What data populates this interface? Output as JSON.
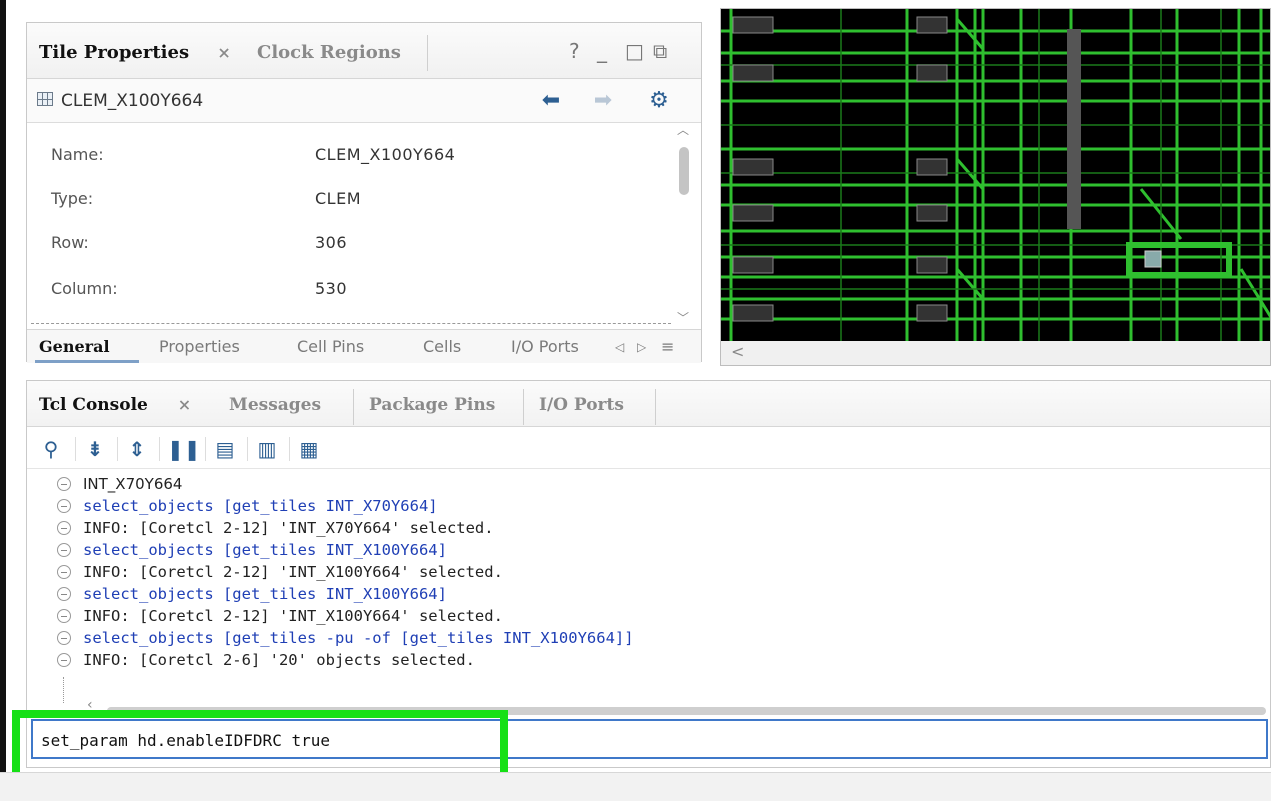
{
  "tile_panel": {
    "tabs": [
      {
        "label": "Tile Properties",
        "active": true
      },
      {
        "label": "Clock Regions",
        "active": false
      }
    ],
    "controls": {
      "help": "?",
      "minimize": "_",
      "maximize": "□",
      "float": "⧉"
    },
    "tile_name": "CLEM_X100Y664",
    "properties": [
      {
        "key": "Name:",
        "value": "CLEM_X100Y664"
      },
      {
        "key": "Type:",
        "value": "CLEM"
      },
      {
        "key": "Row:",
        "value": "306"
      },
      {
        "key": "Column:",
        "value": "530"
      }
    ],
    "bottom_tabs": [
      "General",
      "Properties",
      "Cell Pins",
      "Cells",
      "I/O Ports"
    ]
  },
  "console": {
    "tabs": [
      {
        "label": "Tcl Console",
        "active": true
      },
      {
        "label": "Messages",
        "active": false
      },
      {
        "label": "Package Pins",
        "active": false
      },
      {
        "label": "I/O Ports",
        "active": false
      }
    ],
    "toolbar": [
      "search-icon",
      "collapse-all-icon",
      "expand-all-icon",
      "pause-icon",
      "clear-icon",
      "split-icon",
      "delete-icon"
    ],
    "lines": [
      {
        "kind": "first",
        "text": "INT_X70Y664"
      },
      {
        "kind": "cmd",
        "text": "select_objects [get_tiles INT_X70Y664]"
      },
      {
        "kind": "out",
        "text": "INFO: [Coretcl 2-12] 'INT_X70Y664' selected."
      },
      {
        "kind": "cmd",
        "text": "select_objects [get_tiles INT_X100Y664]"
      },
      {
        "kind": "out",
        "text": "INFO: [Coretcl 2-12] 'INT_X100Y664' selected."
      },
      {
        "kind": "cmd",
        "text": "select_objects [get_tiles INT_X100Y664]"
      },
      {
        "kind": "out",
        "text": "INFO: [Coretcl 2-12] 'INT_X100Y664' selected."
      },
      {
        "kind": "cmd",
        "text": "select_objects [get_tiles -pu -of [get_tiles INT_X100Y664]]"
      },
      {
        "kind": "out",
        "text": "INFO: [Coretcl 2-6] '20' objects selected."
      }
    ],
    "input_value": "set_param hd.enableIDFDRC true"
  },
  "colors": {
    "highlight": "#16e016",
    "command_text": "#1f3fb5",
    "device_wire": "#2fbf2f"
  }
}
